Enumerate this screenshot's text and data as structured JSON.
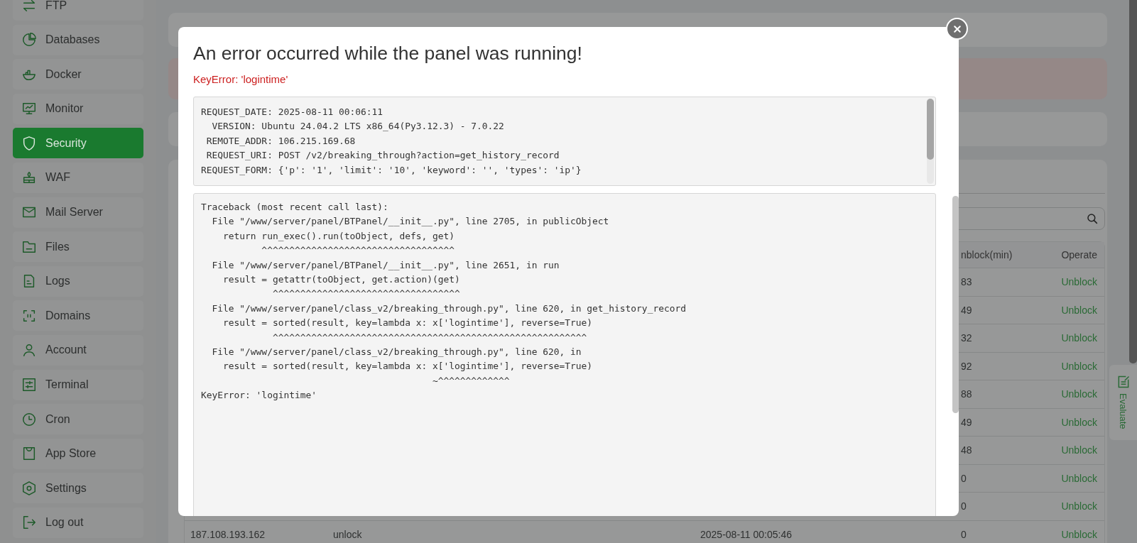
{
  "sidebar": {
    "items": [
      {
        "label": "FTP",
        "selected": false
      },
      {
        "label": "Databases",
        "selected": false
      },
      {
        "label": "Docker",
        "selected": false
      },
      {
        "label": "Monitor",
        "selected": false
      },
      {
        "label": "Security",
        "selected": true
      },
      {
        "label": "WAF",
        "selected": false
      },
      {
        "label": "Mail Server",
        "selected": false
      },
      {
        "label": "Files",
        "selected": false
      },
      {
        "label": "Logs",
        "selected": false
      },
      {
        "label": "Domains",
        "selected": false
      },
      {
        "label": "Account",
        "selected": false
      },
      {
        "label": "Terminal",
        "selected": false
      },
      {
        "label": "Cron",
        "selected": false
      },
      {
        "label": "App Store",
        "selected": false
      },
      {
        "label": "Settings",
        "selected": false
      },
      {
        "label": "Log out",
        "selected": false
      }
    ]
  },
  "table": {
    "columns": [
      {
        "label": "nblock(min)"
      },
      {
        "label": "Operate"
      }
    ],
    "rows": [
      {
        "minutes": "83",
        "operate": "Unblock"
      },
      {
        "minutes": "49",
        "operate": "Unblock"
      },
      {
        "minutes": "32",
        "operate": "Unblock"
      },
      {
        "minutes": "92",
        "operate": "Unblock"
      },
      {
        "minutes": "88",
        "operate": "Unblock"
      },
      {
        "minutes": "49",
        "operate": "Unblock"
      },
      {
        "minutes": "48",
        "operate": "Unblock"
      },
      {
        "minutes": "0",
        "operate": "Unblock"
      },
      {
        "minutes": "0",
        "operate": "Unblock"
      },
      {
        "ip": "187.108.193.162",
        "action": "unlock",
        "time": "2025-08-11 00:05:46",
        "minutes": "0",
        "operate": "Unblock"
      }
    ]
  },
  "evaluate": {
    "label": "Evaluate"
  },
  "modal": {
    "title": "An error occurred while the panel was running!",
    "error": "KeyError: 'logintime'",
    "request_lines": [
      "REQUEST_DATE: 2025-08-11 00:06:11",
      "  VERSION: Ubuntu 24.04.2 LTS x86_64(Py3.12.3) - 7.0.22",
      " REMOTE_ADDR: 106.215.169.68",
      " REQUEST_URI: POST /v2/breaking_through?action=get_history_record",
      "REQUEST_FORM: {'p': '1', 'limit': '10', 'keyword': '', 'types': 'ip'}"
    ],
    "traceback_lines": [
      "Traceback (most recent call last):",
      "  File \"/www/server/panel/BTPanel/__init__.py\", line 2705, in publicObject",
      "    return run_exec().run(toObject, defs, get)",
      "           ^^^^^^^^^^^^^^^^^^^^^^^^^^^^^^^^^^^",
      "  File \"/www/server/panel/BTPanel/__init__.py\", line 2651, in run",
      "    result = getattr(toObject, get.action)(get)",
      "             ^^^^^^^^^^^^^^^^^^^^^^^^^^^^^^^^^^",
      "  File \"/www/server/panel/class_v2/breaking_through.py\", line 620, in get_history_record",
      "    result = sorted(result, key=lambda x: x['logintime'], reverse=True)",
      "             ^^^^^^^^^^^^^^^^^^^^^^^^^^^^^^^^^^^^^^^^^^^^^^^^^^^^^^^^^",
      "  File \"/www/server/panel/class_v2/breaking_through.py\", line 620, in",
      "    result = sorted(result, key=lambda x: x['logintime'], reverse=True)",
      "                                          ~^^^^^^^^^^^^^",
      "KeyError: 'logintime'"
    ]
  }
}
